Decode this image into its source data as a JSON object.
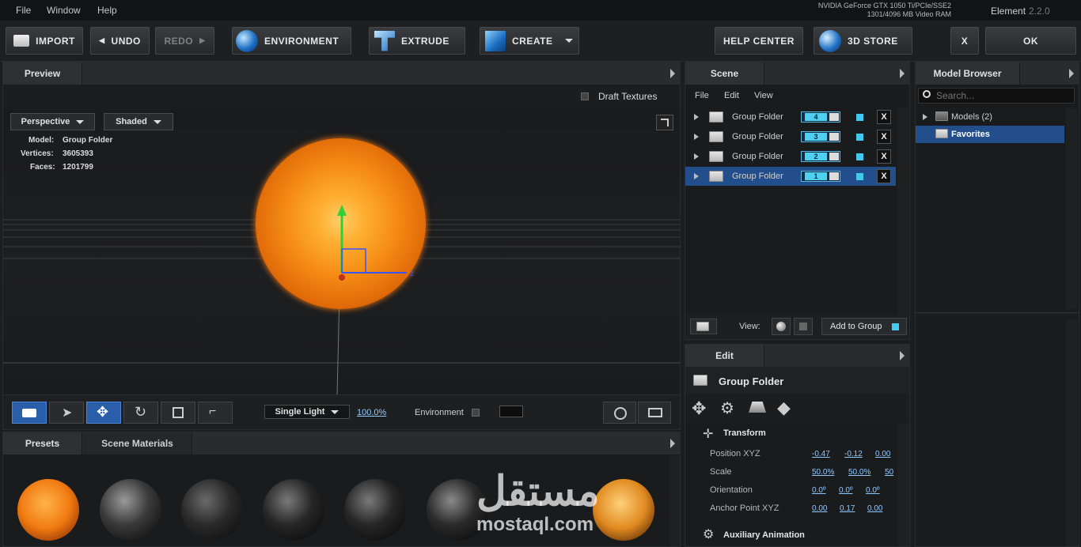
{
  "menu": {
    "file": "File",
    "window": "Window",
    "help": "Help"
  },
  "gpu_info": {
    "line1": "NVIDIA GeForce GTX 1050 Ti/PCIe/SSE2",
    "line2": "1301/4096 MB Video RAM"
  },
  "app": {
    "name": "Element",
    "version": "2.2.0"
  },
  "toolbar": {
    "import": "IMPORT",
    "undo": "UNDO",
    "redo": "REDO",
    "environment": "ENVIRONMENT",
    "extrude": "EXTRUDE",
    "create": "CREATE",
    "help_center": "HELP CENTER",
    "store": "3D STORE",
    "close": "X",
    "ok": "OK"
  },
  "preview": {
    "tab": "Preview",
    "draft_textures": "Draft Textures",
    "camera_mode": "Perspective",
    "render_mode": "Shaded",
    "model_label": "Model:",
    "model_value": "Group Folder",
    "vertices_label": "Vertices:",
    "vertices_value": "3605393",
    "faces_label": "Faces:",
    "faces_value": "1201799",
    "light_mode": "Single Light",
    "light_percent": "100.0%",
    "environment_label": "Environment"
  },
  "scene": {
    "tab": "Scene",
    "menu": [
      "File",
      "Edit",
      "View"
    ],
    "rows": [
      {
        "name": "Group Folder",
        "group": "4"
      },
      {
        "name": "Group Folder",
        "group": "3"
      },
      {
        "name": "Group Folder",
        "group": "2"
      },
      {
        "name": "Group Folder",
        "group": "1"
      }
    ],
    "view_label": "View:",
    "add_to_group": "Add to Group"
  },
  "model_browser": {
    "tab": "Model Browser",
    "search_placeholder": "Search...",
    "models": "Models (2)",
    "favorites": "Favorites"
  },
  "edit": {
    "tab": "Edit",
    "title": "Group Folder",
    "transform": "Transform",
    "position_label": "Position XYZ",
    "position": [
      "-0.47",
      "-0.12",
      "0.00"
    ],
    "scale_label": "Scale",
    "scale": [
      "50.0%",
      "50.0%",
      "50"
    ],
    "orientation_label": "Orientation",
    "orientation": [
      "0.0º",
      "0.0º",
      "0.0º"
    ],
    "anchor_label": "Anchor Point XYZ",
    "anchor": [
      "0.00",
      "0.17",
      "0.00"
    ],
    "aux": "Auxiliary Animation"
  },
  "presets": {
    "tab_presets": "Presets",
    "tab_materials": "Scene Materials"
  },
  "watermark": {
    "arabic": "مستقل",
    "latin": "mostaql.com"
  },
  "colors": {
    "accent": "#43c8f0",
    "selection": "#234e8c",
    "sphere": "#f07a10"
  }
}
